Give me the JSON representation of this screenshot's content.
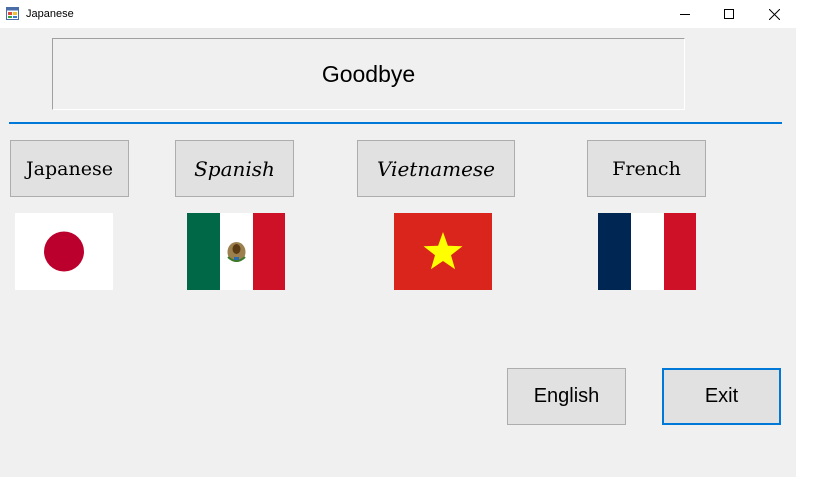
{
  "window": {
    "title": "Japanese",
    "icon": "windows-form-icon"
  },
  "display": {
    "text": "Goodbye"
  },
  "language_buttons": [
    {
      "label": "Japanese",
      "flag": "japan-flag"
    },
    {
      "label": "Spanish",
      "flag": "mexico-flag"
    },
    {
      "label": "Vietnamese",
      "flag": "vietnam-flag"
    },
    {
      "label": "French",
      "flag": "france-flag"
    }
  ],
  "actions": {
    "english_label": "English",
    "exit_label": "Exit"
  },
  "colors": {
    "accent": "#0078d7",
    "japan_red": "#bc002d",
    "mexico_green": "#006847",
    "mexico_red": "#ce1126",
    "vietnam_red": "#da251d",
    "vietnam_star": "#ffff00",
    "france_blue": "#002654",
    "france_red": "#ce1126"
  }
}
